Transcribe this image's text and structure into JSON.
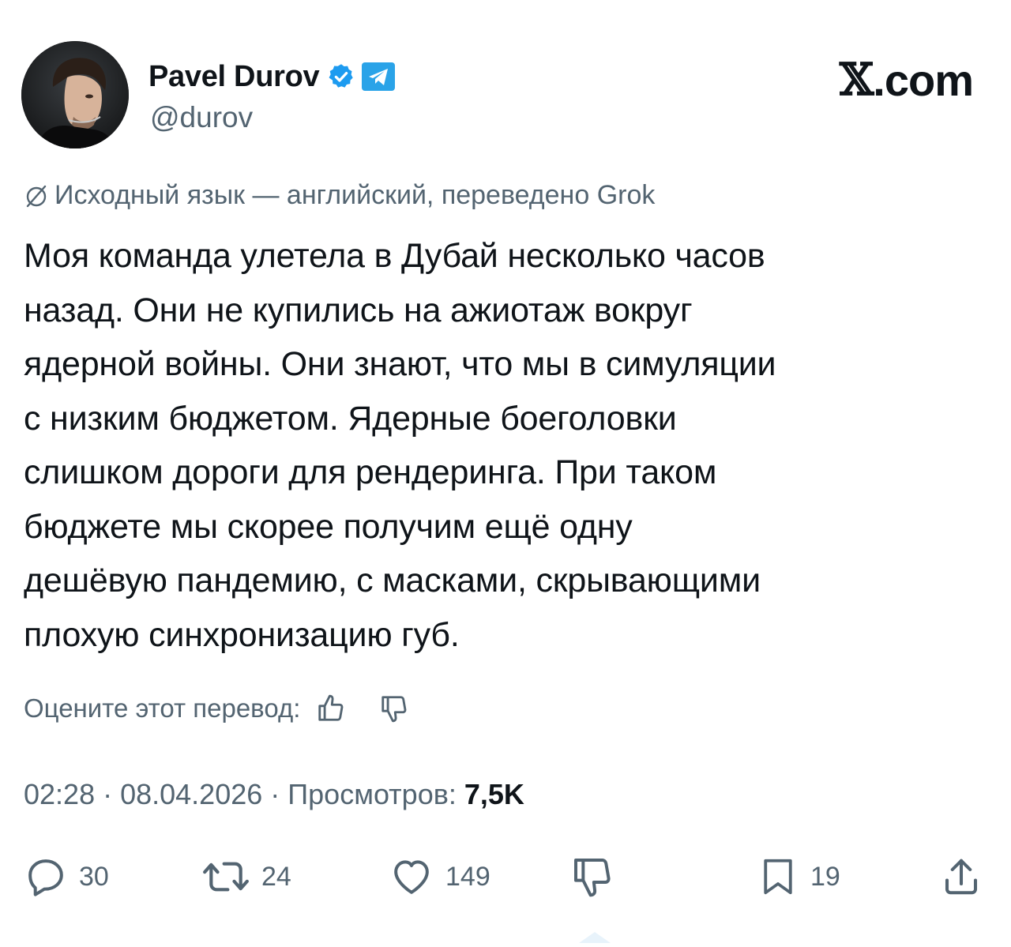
{
  "author": {
    "name": "Pavel Durov",
    "handle": "@durov",
    "verified_color": "#1d9bf0",
    "badge_color": "#2aa3e8"
  },
  "site": {
    "logo_mark": "𝕏",
    "logo_text": ".com"
  },
  "translation": {
    "icon": "globe-slash-icon",
    "note": "Исходный язык — английский, переведено Grok",
    "rate_label": "Оцените этот перевод:"
  },
  "tweet": {
    "lines": [
      "Моя команда улетела в Дубай несколько часов",
      "назад. Они не купились на ажиотаж вокруг",
      "ядерной войны. Они знают, что мы в симуляции",
      "с низким бюджетом. Ядерные боеголовки",
      "слишком дороги для рендеринга. При таком",
      "бюджете мы скорее получим ещё одну",
      "дешёвую пандемию, с масками, скрывающими",
      "плохую синхронизацию губ."
    ]
  },
  "meta": {
    "time": "02:28",
    "date": "08.04.2026",
    "views_label": "Просмотров:",
    "views_count": "7,5K",
    "separator": "·"
  },
  "actions": {
    "replies": "30",
    "reposts": "24",
    "likes": "149",
    "bookmarks": "19"
  },
  "colors": {
    "text": "#0f1419",
    "muted": "#536471",
    "accent": "#1d9bf0"
  }
}
